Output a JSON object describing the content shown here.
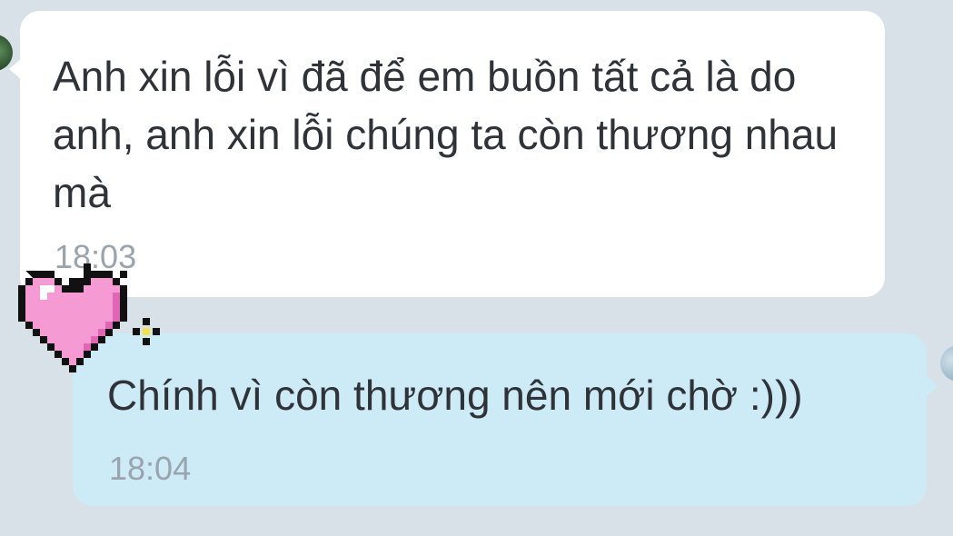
{
  "messages": {
    "received": {
      "text": "Anh xin lỗi vì đã để em buồn tất cả là do anh, anh xin lỗi chúng ta còn thương nhau mà",
      "time": "18:03"
    },
    "sent": {
      "text": "Chính vì còn thương nên mới chờ :)))",
      "time": "18:04"
    }
  },
  "stickers": {
    "heart_icon": "pink-pixel-heart-icon",
    "sparkle_icon": "sparkle-icon"
  },
  "colors": {
    "background": "#d8e1e8",
    "received_bubble": "#ffffff",
    "sent_bubble": "#cdeaf7",
    "message_text": "#2f3338",
    "timestamp": "#9aa4ad",
    "heart": "#f59ad3"
  }
}
